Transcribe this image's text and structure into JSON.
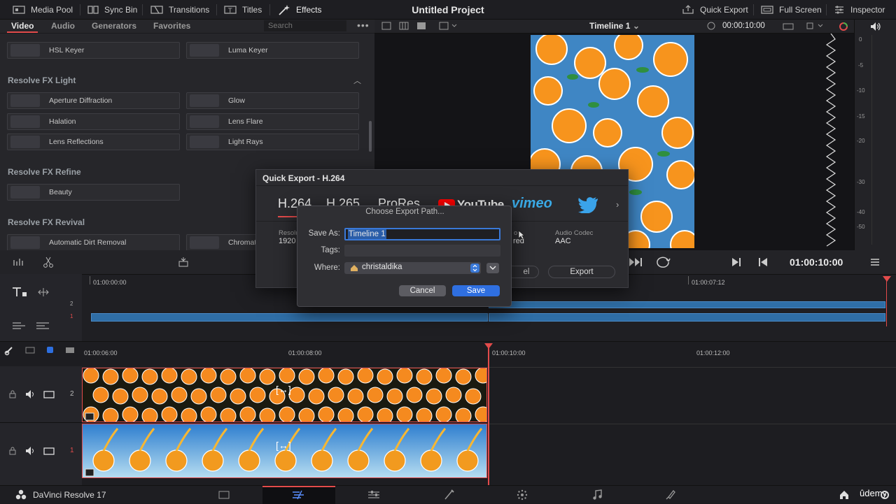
{
  "topbar": {
    "media_pool": "Media Pool",
    "sync_bin": "Sync Bin",
    "transitions": "Transitions",
    "titles": "Titles",
    "effects": "Effects",
    "project_title": "Untitled Project",
    "quick_export": "Quick Export",
    "full_screen": "Full Screen",
    "inspector": "Inspector"
  },
  "effects_panel": {
    "tabs": [
      "Video",
      "Audio",
      "Generators",
      "Favorites"
    ],
    "search_placeholder": "Search",
    "keyer_tiles": [
      "HSL Keyer",
      "Luma Keyer"
    ],
    "sections": {
      "light": {
        "title": "Resolve FX Light",
        "items": [
          "Aperture Diffraction",
          "Glow",
          "Halation",
          "Lens Flare",
          "Lens Reflections",
          "Light Rays"
        ]
      },
      "refine": {
        "title": "Resolve FX Refine",
        "items": [
          "Beauty"
        ]
      },
      "revival": {
        "title": "Resolve FX Revival",
        "items": [
          "Automatic Dirt Removal",
          "Chromat"
        ]
      }
    }
  },
  "viewer": {
    "timecode_left": "00:00:10:00",
    "timeline_name": "Timeline 1",
    "transport_timecode": "01:00:10:00"
  },
  "audio_meter": {
    "ticks": [
      "0",
      "-5",
      "-10",
      "-15",
      "-20",
      "-30",
      "-40",
      "-50"
    ]
  },
  "upper_timeline": {
    "ruler": [
      "01:00:00:00",
      "01:00:07:12"
    ],
    "tracks": [
      "2",
      "1"
    ]
  },
  "lower_timeline": {
    "ruler": [
      "01:00:06:00",
      "01:00:08:00",
      "01:00:10:00",
      "01:00:12:00"
    ],
    "tracks": [
      "2",
      "1"
    ]
  },
  "quick_export": {
    "title": "Quick Export - H.264",
    "formats": [
      "H.264",
      "H.265",
      "ProRes"
    ],
    "youtube": "YouTube",
    "vimeo": "vimeo",
    "resolution_label": "Resolu",
    "resolution_value": "1920",
    "video_label": "o",
    "video_value": "red",
    "audio_codec_label": "Audio Codec",
    "audio_codec_value": "AAC",
    "cancel_fragment": "el",
    "export_label": "Export"
  },
  "save_sheet": {
    "title": "Choose Export Path...",
    "save_as_label": "Save As:",
    "save_as_value": "Timeline 1",
    "tags_label": "Tags:",
    "where_label": "Where:",
    "where_value": "christaldika",
    "cancel_label": "Cancel",
    "save_label": "Save"
  },
  "bottombar": {
    "app_name": "DaVinci Resolve 17",
    "watermark": "ûdemy"
  },
  "colors": {
    "accent_red": "#e34b4b",
    "selection_blue": "#3a79d8",
    "clip_blue": "#2f6ea6",
    "bg": "#1b1b1f"
  }
}
